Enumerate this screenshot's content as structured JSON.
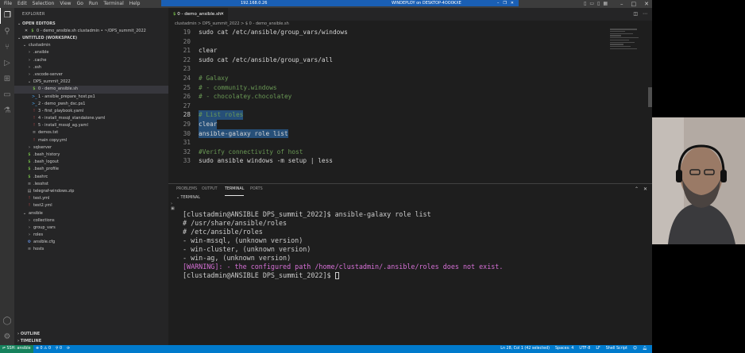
{
  "titlebar": {
    "menu": [
      "File",
      "Edit",
      "Selection",
      "View",
      "Go",
      "Run",
      "Terminal",
      "Help"
    ],
    "rdp_ip": "192.168.0.26",
    "rdp_title": "WINDEPLOY on DESKTOP-4OO0KXE"
  },
  "sidebar": {
    "title": "EXPLORER",
    "open_editors_label": "OPEN EDITORS",
    "open_editor": "0 - demo_ansible.sh  clustadmin • ~/DPS_summit_2022",
    "workspace_label": "UNTITLED (WORKSPACE)",
    "tree": [
      {
        "label": "clustadmin",
        "indent": 1,
        "icon": "chevron-down",
        "kind": "folder"
      },
      {
        "label": ".ansible",
        "indent": 2,
        "icon": "chevron-right",
        "kind": "folder"
      },
      {
        "label": ".cache",
        "indent": 2,
        "icon": "chevron-right",
        "kind": "folder"
      },
      {
        "label": ".ssh",
        "indent": 2,
        "icon": "chevron-right",
        "kind": "folder"
      },
      {
        "label": ".vscode-server",
        "indent": 2,
        "icon": "chevron-right",
        "kind": "folder"
      },
      {
        "label": "DPS_summit_2022",
        "indent": 2,
        "icon": "chevron-down",
        "kind": "folder"
      },
      {
        "label": "0 - demo_ansible.sh",
        "indent": 3,
        "icon": "$",
        "kind": "sh",
        "selected": true
      },
      {
        "label": "1 - ansible_prepare_host.ps1",
        "indent": 3,
        "icon": ">_",
        "kind": "ps"
      },
      {
        "label": "2 - demo_pwsh_dsc.ps1",
        "indent": 3,
        "icon": ">_",
        "kind": "ps"
      },
      {
        "label": "3 - first_playbook.yaml",
        "indent": 3,
        "icon": "!",
        "kind": "yml"
      },
      {
        "label": "4 - install_mssql_standalone.yaml",
        "indent": 3,
        "icon": "!",
        "kind": "yml"
      },
      {
        "label": "5 - install_mssql_ag.yaml",
        "indent": 3,
        "icon": "!",
        "kind": "yml"
      },
      {
        "label": "demos.txt",
        "indent": 3,
        "icon": "≡",
        "kind": "txt"
      },
      {
        "label": "main copy.yml",
        "indent": 3,
        "icon": "!",
        "kind": "yml"
      },
      {
        "label": "sqlserver",
        "indent": 2,
        "icon": "chevron-right",
        "kind": "folder"
      },
      {
        "label": ".bash_history",
        "indent": 2,
        "icon": "$",
        "kind": "sh"
      },
      {
        "label": ".bash_logout",
        "indent": 2,
        "icon": "$",
        "kind": "sh"
      },
      {
        "label": ".bash_profile",
        "indent": 2,
        "icon": "$",
        "kind": "sh"
      },
      {
        "label": ".bashrc",
        "indent": 2,
        "icon": "$",
        "kind": "sh"
      },
      {
        "label": ".lesshst",
        "indent": 2,
        "icon": "≡",
        "kind": "txt"
      },
      {
        "label": "telegraf-windows.zip",
        "indent": 2,
        "icon": "▤",
        "kind": "txt"
      },
      {
        "label": "test.yml",
        "indent": 2,
        "icon": "!",
        "kind": "yml"
      },
      {
        "label": "test2.yml",
        "indent": 2,
        "icon": "!",
        "kind": "yml"
      },
      {
        "label": "ansible",
        "indent": 1,
        "icon": "chevron-down",
        "kind": "folder"
      },
      {
        "label": "collections",
        "indent": 2,
        "icon": "chevron-right",
        "kind": "folder"
      },
      {
        "label": "group_vars",
        "indent": 2,
        "icon": "chevron-right",
        "kind": "folder"
      },
      {
        "label": "roles",
        "indent": 2,
        "icon": "chevron-right",
        "kind": "folder"
      },
      {
        "label": "ansible.cfg",
        "indent": 2,
        "icon": "⚙",
        "kind": "cfg"
      },
      {
        "label": "hosts",
        "indent": 2,
        "icon": "≡",
        "kind": "txt"
      }
    ],
    "outline_label": "OUTLINE",
    "timeline_label": "TIMELINE"
  },
  "editor": {
    "tab_label": "0 - demo_ansible.sh",
    "breadcrumb": "clustadmin  >  DPS_summit_2022  >  $  0 - demo_ansible.sh",
    "lines": [
      {
        "n": "19",
        "text": "sudo cat /etc/ansible/group_vars/windows",
        "type": "code"
      },
      {
        "n": "20",
        "text": "",
        "type": "code"
      },
      {
        "n": "21",
        "text": "clear",
        "type": "code"
      },
      {
        "n": "22",
        "text": "sudo cat /etc/ansible/group_vars/all",
        "type": "code"
      },
      {
        "n": "23",
        "text": "",
        "type": "code"
      },
      {
        "n": "24",
        "text": "# Galaxy",
        "type": "comment"
      },
      {
        "n": "25",
        "text": "# - community.windows",
        "type": "comment"
      },
      {
        "n": "26",
        "text": "# - chocolatey.chocolatey",
        "type": "comment"
      },
      {
        "n": "27",
        "text": "",
        "type": "code"
      },
      {
        "n": "28",
        "text": "# List roles",
        "type": "comment",
        "selected": true,
        "current": true
      },
      {
        "n": "29",
        "text": "clear",
        "type": "code",
        "selected": true
      },
      {
        "n": "30",
        "text": "ansible-galaxy role list",
        "type": "code",
        "selected": true
      },
      {
        "n": "31",
        "text": "",
        "type": "code"
      },
      {
        "n": "32",
        "text": "#Verify connectivity of host",
        "type": "comment"
      },
      {
        "n": "33",
        "text": "sudo ansible windows -m setup | less",
        "type": "code"
      }
    ]
  },
  "panel": {
    "tabs": [
      "PROBLEMS",
      "OUTPUT",
      "TERMINAL",
      "PORTS"
    ],
    "active_tab": "TERMINAL",
    "terminal_label": "TERMINAL",
    "terminal_lines": [
      {
        "text": "[clustadmin@ANSIBLE DPS_summit_2022]$ ansible-galaxy role list",
        "type": "normal"
      },
      {
        "text": "# /usr/share/ansible/roles",
        "type": "normal"
      },
      {
        "text": "# /etc/ansible/roles",
        "type": "normal"
      },
      {
        "text": "- win-mssql, (unknown version)",
        "type": "normal"
      },
      {
        "text": "- win-cluster, (unknown version)",
        "type": "normal"
      },
      {
        "text": "- win-ag, (unknown version)",
        "type": "normal"
      },
      {
        "text": "[WARNING]: - the configured path /home/clustadmin/.ansible/roles does not exist.",
        "type": "warn"
      },
      {
        "text": "[clustadmin@ANSIBLE DPS_summit_2022]$ ",
        "type": "prompt"
      }
    ]
  },
  "statusbar": {
    "remote": "SSH: ansible",
    "errors": "⊗ 0 ⚠ 0",
    "ports": "⚲ 0",
    "position": "Ln 28, Col 1 (42 selected)",
    "spaces": "Spaces: 4",
    "encoding": "UTF-8",
    "eol": "LF",
    "language": "Shell Script"
  },
  "colors": {
    "accent": "#007acc",
    "remote": "#16825d",
    "selection": "#264f78",
    "comment": "#6a9955",
    "warning": "#d670d6"
  }
}
